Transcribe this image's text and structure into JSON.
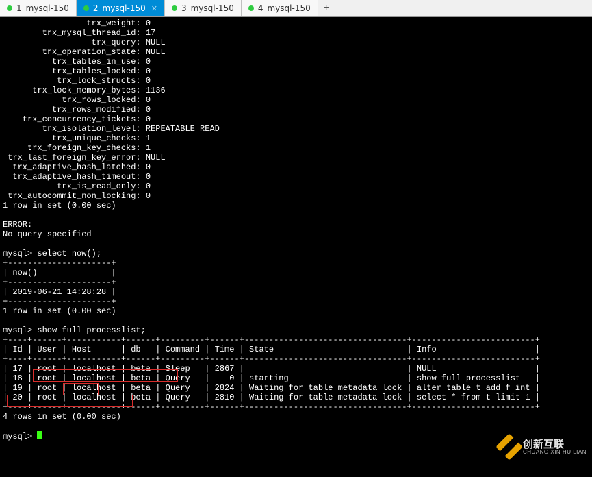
{
  "tabs": {
    "items": [
      {
        "num": "1",
        "label": "mysql-150",
        "active": false
      },
      {
        "num": "2",
        "label": "mysql-150",
        "active": true
      },
      {
        "num": "3",
        "label": "mysql-150",
        "active": false
      },
      {
        "num": "4",
        "label": "mysql-150",
        "active": false
      }
    ],
    "add": "+"
  },
  "trx_status": [
    {
      "k": "trx_weight",
      "v": "0"
    },
    {
      "k": "trx_mysql_thread_id",
      "v": "17"
    },
    {
      "k": "trx_query",
      "v": "NULL"
    },
    {
      "k": "trx_operation_state",
      "v": "NULL"
    },
    {
      "k": "trx_tables_in_use",
      "v": "0"
    },
    {
      "k": "trx_tables_locked",
      "v": "0"
    },
    {
      "k": "trx_lock_structs",
      "v": "0"
    },
    {
      "k": "trx_lock_memory_bytes",
      "v": "1136"
    },
    {
      "k": "trx_rows_locked",
      "v": "0"
    },
    {
      "k": "trx_rows_modified",
      "v": "0"
    },
    {
      "k": "trx_concurrency_tickets",
      "v": "0"
    },
    {
      "k": "trx_isolation_level",
      "v": "REPEATABLE READ"
    },
    {
      "k": "trx_unique_checks",
      "v": "1"
    },
    {
      "k": "trx_foreign_key_checks",
      "v": "1"
    },
    {
      "k": "trx_last_foreign_key_error",
      "v": "NULL"
    },
    {
      "k": "trx_adaptive_hash_latched",
      "v": "0"
    },
    {
      "k": "trx_adaptive_hash_timeout",
      "v": "0"
    },
    {
      "k": "trx_is_read_only",
      "v": "0"
    },
    {
      "k": "trx_autocommit_non_locking",
      "v": "0"
    }
  ],
  "trx_footer": "1 row in set (0.00 sec)",
  "error_block": {
    "l1": "ERROR:",
    "l2": "No query specified"
  },
  "prompt": "mysql>",
  "q1": {
    "cmd": "select now();",
    "col": "now()",
    "val": "2019-06-21 14:28:28",
    "footer": "1 row in set (0.00 sec)"
  },
  "q2": {
    "cmd": "show full processlist;",
    "headers": [
      "Id",
      "User",
      "Host",
      "db",
      "Command",
      "Time",
      "State",
      "Info"
    ],
    "rows": [
      {
        "Id": "17",
        "User": "root",
        "Host": "localhost",
        "db": "beta",
        "Command": "Sleep",
        "Time": "2867",
        "State": "",
        "Info": "NULL"
      },
      {
        "Id": "18",
        "User": "root",
        "Host": "localhost",
        "db": "beta",
        "Command": "Query",
        "Time": "0",
        "State": "starting",
        "Info": "show full processlist"
      },
      {
        "Id": "19",
        "User": "root",
        "Host": "localhost",
        "db": "beta",
        "Command": "Query",
        "Time": "2824",
        "State": "Waiting for table metadata lock",
        "Info": "alter table t add f int"
      },
      {
        "Id": "20",
        "User": "root",
        "Host": "localhost",
        "db": "beta",
        "Command": "Query",
        "Time": "2810",
        "State": "Waiting for table metadata lock",
        "Info": "select * from t limit 1"
      }
    ],
    "footer": "4 rows in set (0.00 sec)"
  },
  "watermark": {
    "cn": "创新互联",
    "en": "CHUANG XIN HU LIAN"
  }
}
